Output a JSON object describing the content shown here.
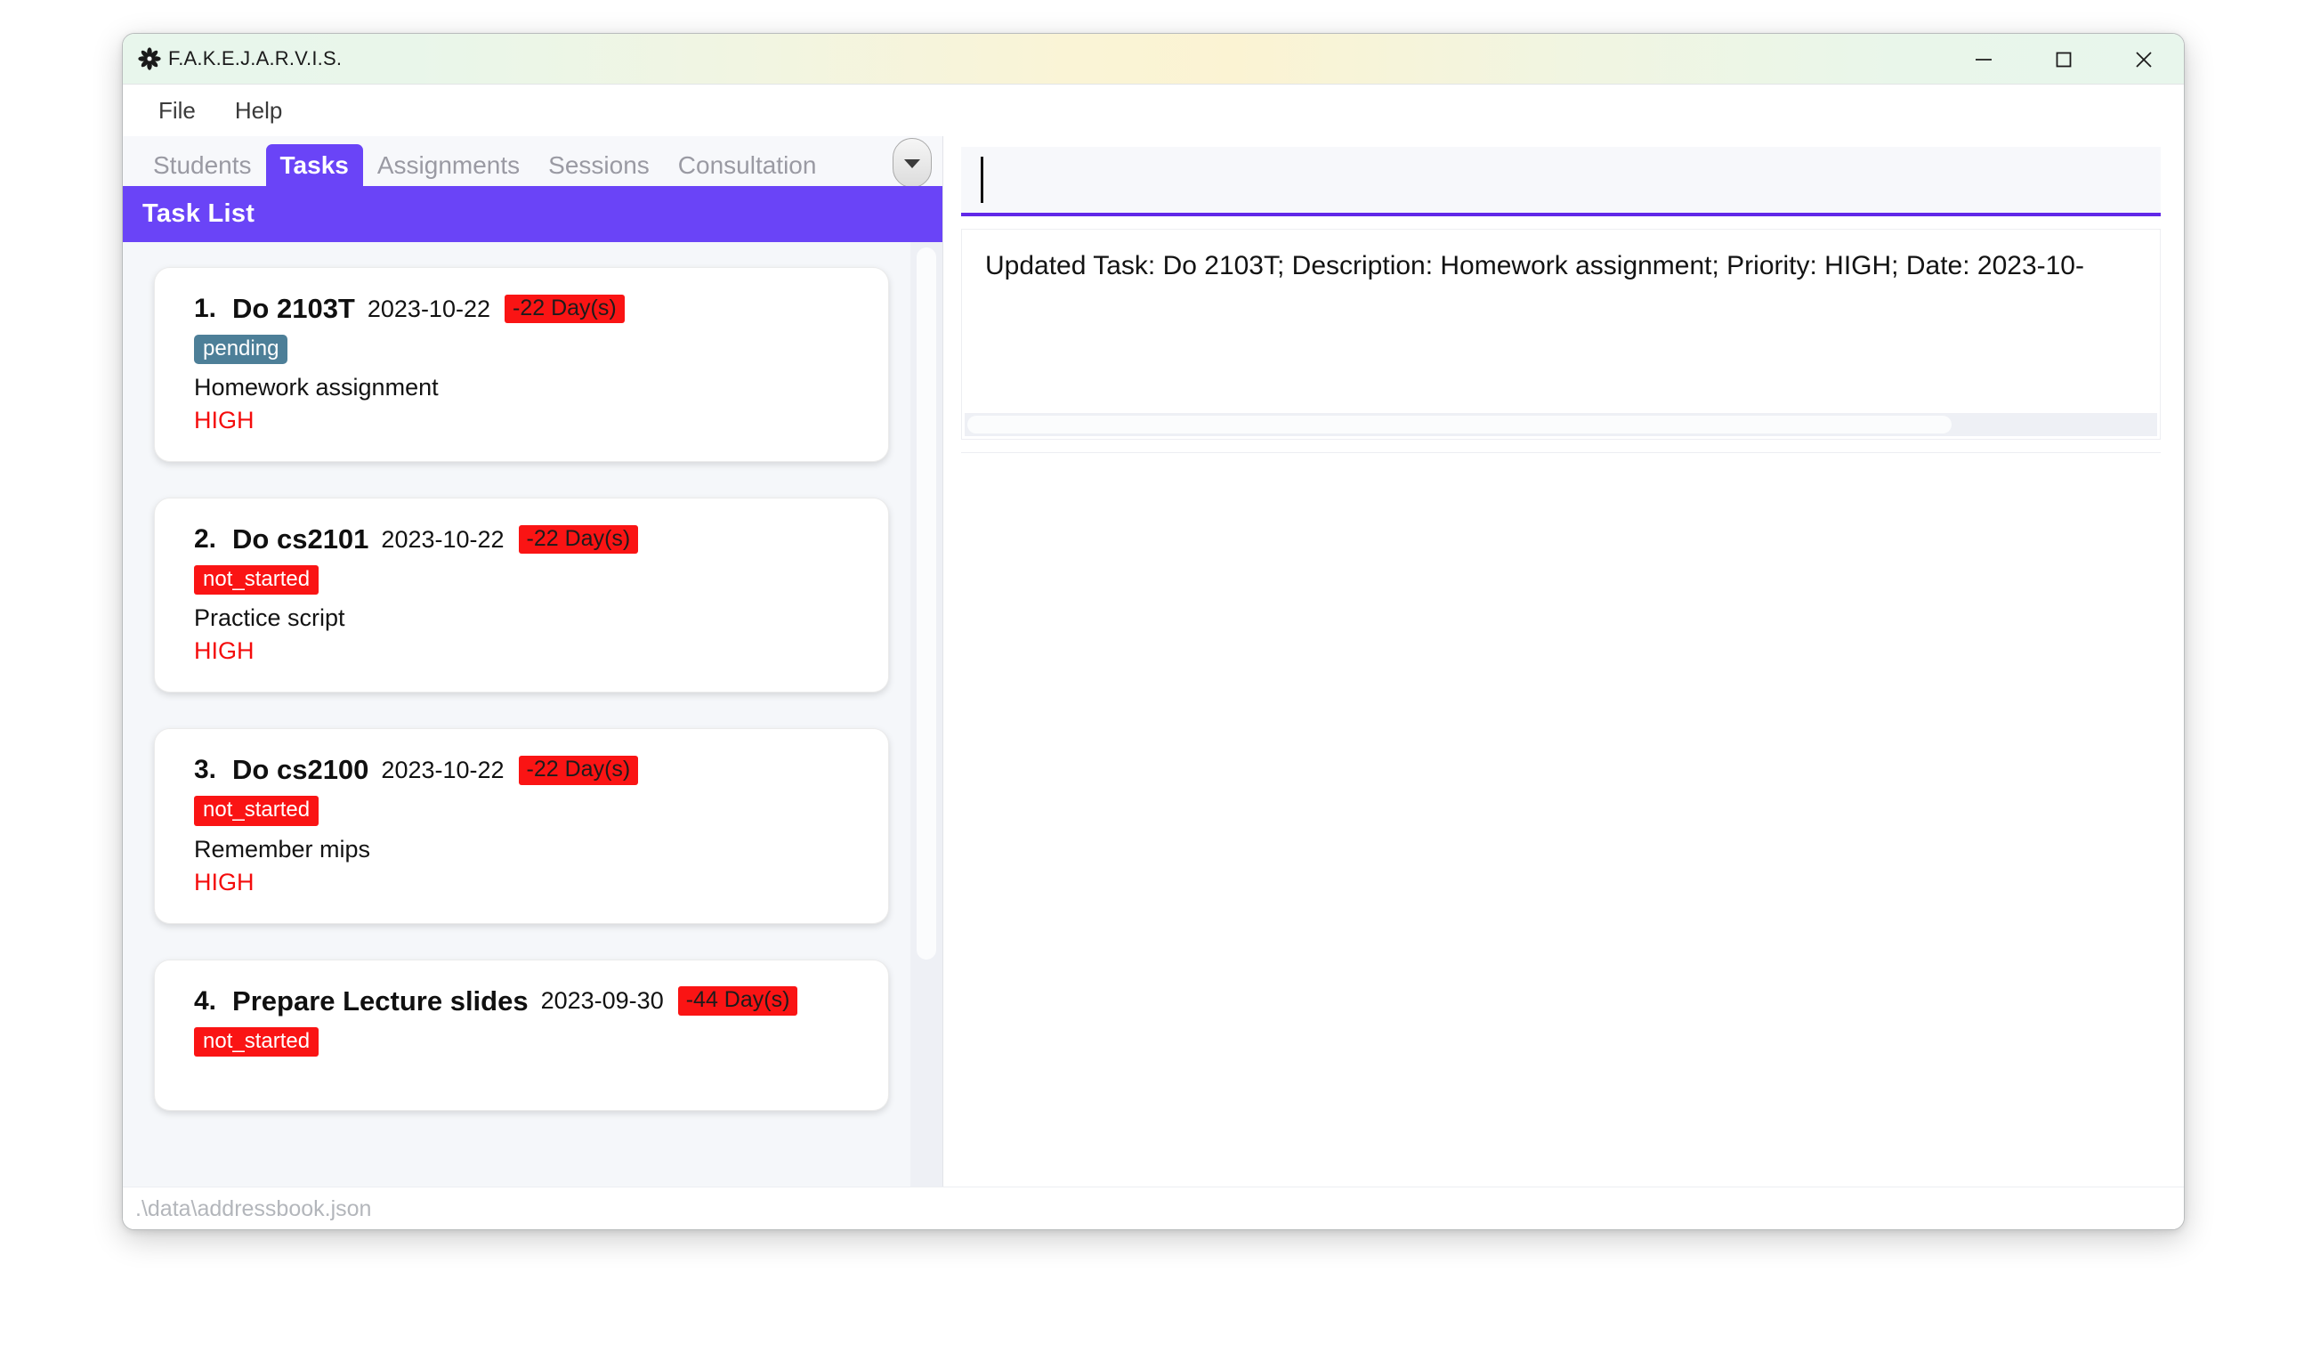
{
  "window": {
    "title": "F.A.K.E.J.A.R.V.I.S.",
    "app_icon": "flower-icon",
    "controls": {
      "minimize": "minimize-icon",
      "maximize": "maximize-icon",
      "close": "close-icon"
    },
    "accent_purple": "#6a44f7",
    "command_underline": "#6128e8",
    "danger_red": "#fa1414",
    "pending_teal": "#4d7f98"
  },
  "menu": {
    "items": [
      {
        "label": "File"
      },
      {
        "label": "Help"
      }
    ]
  },
  "tabs": {
    "items": [
      {
        "label": "Students",
        "active": false
      },
      {
        "label": "Tasks",
        "active": true
      },
      {
        "label": "Assignments",
        "active": false
      },
      {
        "label": "Sessions",
        "active": false
      },
      {
        "label": "Consultation",
        "active": false
      }
    ],
    "overflow_icon": "chevron-down-icon"
  },
  "task_list": {
    "header": "Task List",
    "items": [
      {
        "index": "1.",
        "name": "Do 2103T",
        "date": "2023-10-22",
        "days": "-22 Day(s)",
        "status": "pending",
        "status_kind": "pending",
        "description": "Homework assignment",
        "priority": "HIGH"
      },
      {
        "index": "2.",
        "name": "Do cs2101",
        "date": "2023-10-22",
        "days": "-22 Day(s)",
        "status": "not_started",
        "status_kind": "not_started",
        "description": "Practice script",
        "priority": "HIGH"
      },
      {
        "index": "3.",
        "name": "Do cs2100",
        "date": "2023-10-22",
        "days": "-22 Day(s)",
        "status": "not_started",
        "status_kind": "not_started",
        "description": "Remember mips",
        "priority": "HIGH"
      },
      {
        "index": "4.",
        "name": "Prepare Lecture slides",
        "date": "2023-09-30",
        "days": "-44 Day(s)",
        "status": "not_started",
        "status_kind": "not_started",
        "description": "",
        "priority": ""
      }
    ]
  },
  "command": {
    "value": "",
    "placeholder": ""
  },
  "result": {
    "text": "Updated Task: Do 2103T; Description: Homework assignment; Priority: HIGH; Date: 2023-10-"
  },
  "status_bar": {
    "file_path": ".\\data\\addressbook.json"
  }
}
